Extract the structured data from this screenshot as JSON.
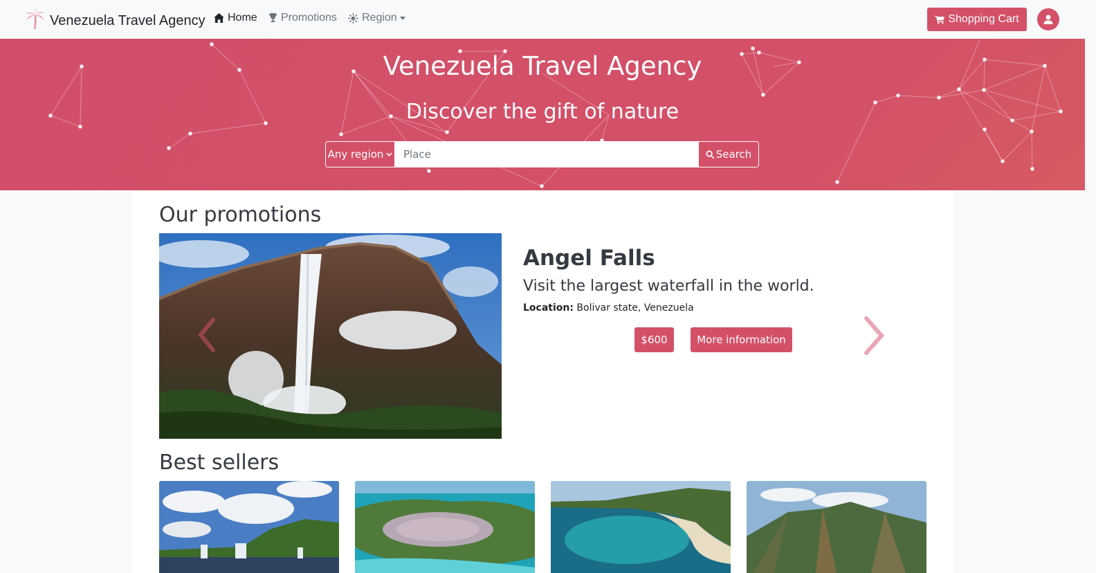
{
  "navbar": {
    "brand": "Venezuela Travel Agency",
    "brand_icon": "palm-tree-icon",
    "links": [
      {
        "label": "Home",
        "icon": "home-icon",
        "active": true
      },
      {
        "label": "Promotions",
        "icon": "trophy-icon",
        "active": false
      },
      {
        "label": "Region",
        "icon": "sun-icon",
        "active": false,
        "dropdown": true
      }
    ],
    "cart_label": "Shopping Cart",
    "cart_icon": "cart-icon",
    "user_icon": "user-icon"
  },
  "hero": {
    "title": "Venezuela Travel Agency",
    "subtitle": "Discover the gift of nature",
    "region_select": "Any region",
    "place_placeholder": "Place",
    "search_label": "Search"
  },
  "promotions": {
    "section_title": "Our promotions",
    "current": {
      "title": "Angel Falls",
      "description": "Visit the largest waterfall in the world.",
      "location_label": "Location:",
      "location_value": "Bolivar state, Venezuela",
      "price": "$600",
      "more_label": "More information"
    }
  },
  "best_sellers": {
    "section_title": "Best sellers",
    "cards": [
      {
        "image": "canaima-lagoon-photo"
      },
      {
        "image": "caribbean-island-photo"
      },
      {
        "image": "beach-bay-photo"
      },
      {
        "image": "mountain-range-photo"
      }
    ]
  },
  "colors": {
    "primary": "#d35068",
    "navbar_bg": "#f8f9fa",
    "text_dark": "#343a40"
  }
}
